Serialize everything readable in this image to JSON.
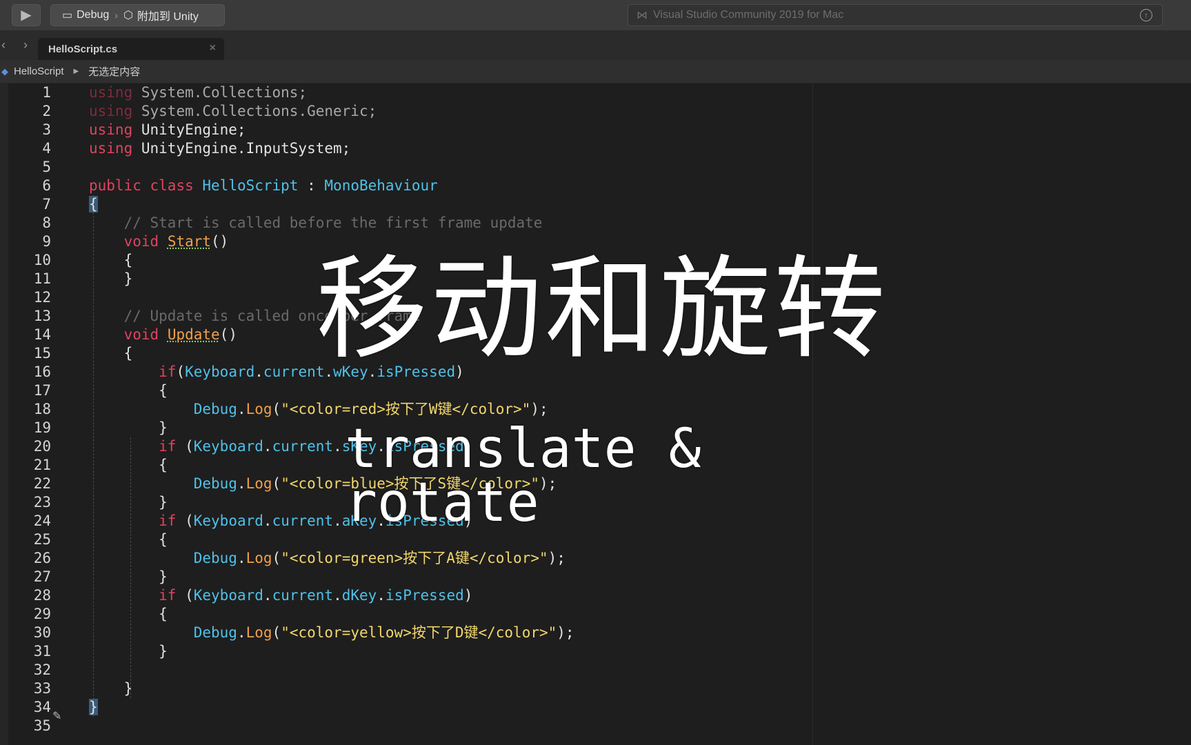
{
  "toolbar": {
    "run_icon": "play-icon",
    "config": "Debug",
    "separator": "›",
    "target": "附加到 Unity",
    "status_text": "Visual Studio Community 2019 for Mac"
  },
  "tabs": [
    {
      "label": "HelloScript.cs",
      "close": "×"
    }
  ],
  "breadcrumb": {
    "class_name": "HelloScript",
    "selection": "无选定内容"
  },
  "editor": {
    "line_numbers": [
      "1",
      "2",
      "3",
      "4",
      "5",
      "6",
      "7",
      "8",
      "9",
      "10",
      "11",
      "12",
      "13",
      "14",
      "15",
      "16",
      "17",
      "18",
      "19",
      "20",
      "21",
      "22",
      "23",
      "24",
      "25",
      "26",
      "27",
      "28",
      "29",
      "30",
      "31",
      "32",
      "33",
      "34",
      "35"
    ],
    "lines": [
      [
        [
          "kw-dim",
          "using"
        ],
        [
          "plain",
          " "
        ],
        [
          "ns-dim",
          "System.Collections;"
        ]
      ],
      [
        [
          "kw-dim",
          "using"
        ],
        [
          "plain",
          " "
        ],
        [
          "ns-dim",
          "System.Collections.Generic;"
        ]
      ],
      [
        [
          "kw",
          "using"
        ],
        [
          "plain",
          " UnityEngine;"
        ]
      ],
      [
        [
          "kw",
          "using"
        ],
        [
          "plain",
          " UnityEngine.InputSystem;"
        ]
      ],
      [],
      [
        [
          "kw",
          "public"
        ],
        [
          "plain",
          " "
        ],
        [
          "kw",
          "class"
        ],
        [
          "plain",
          " "
        ],
        [
          "type",
          "HelloScript"
        ],
        [
          "plain",
          " : "
        ],
        [
          "type",
          "MonoBehaviour"
        ]
      ],
      [
        [
          "brace-hi",
          "{"
        ]
      ],
      [
        [
          "cmt",
          "    // Start is called before the first frame update"
        ]
      ],
      [
        [
          "plain",
          "    "
        ],
        [
          "kw",
          "void"
        ],
        [
          "plain",
          " "
        ],
        [
          "method-u",
          "Start"
        ],
        [
          "plain",
          "()"
        ]
      ],
      [
        [
          "plain",
          "    {"
        ]
      ],
      [
        [
          "plain",
          "    }"
        ]
      ],
      [],
      [
        [
          "cmt",
          "    // Update is called once per frame"
        ]
      ],
      [
        [
          "plain",
          "    "
        ],
        [
          "kw",
          "void"
        ],
        [
          "plain",
          " "
        ],
        [
          "method-u",
          "Update"
        ],
        [
          "plain",
          "()"
        ]
      ],
      [
        [
          "plain",
          "    {"
        ]
      ],
      [
        [
          "plain",
          "        "
        ],
        [
          "kw",
          "if"
        ],
        [
          "plain",
          "("
        ],
        [
          "type",
          "Keyboard"
        ],
        [
          "plain",
          "."
        ],
        [
          "member",
          "current"
        ],
        [
          "plain",
          "."
        ],
        [
          "member",
          "wKey"
        ],
        [
          "plain",
          "."
        ],
        [
          "member",
          "isPressed"
        ],
        [
          "plain",
          ")"
        ]
      ],
      [
        [
          "plain",
          "        {"
        ]
      ],
      [
        [
          "plain",
          "            "
        ],
        [
          "type",
          "Debug"
        ],
        [
          "plain",
          "."
        ],
        [
          "method",
          "Log"
        ],
        [
          "plain",
          "("
        ],
        [
          "str",
          "\"<color=red>按下了W键</color>\""
        ],
        [
          "plain",
          ");"
        ]
      ],
      [
        [
          "plain",
          "        }"
        ]
      ],
      [
        [
          "plain",
          "        "
        ],
        [
          "kw",
          "if"
        ],
        [
          "plain",
          " ("
        ],
        [
          "type",
          "Keyboard"
        ],
        [
          "plain",
          "."
        ],
        [
          "member",
          "current"
        ],
        [
          "plain",
          "."
        ],
        [
          "member",
          "sKey"
        ],
        [
          "plain",
          "."
        ],
        [
          "member",
          "isPressed"
        ],
        [
          "plain",
          ")"
        ]
      ],
      [
        [
          "plain",
          "        {"
        ]
      ],
      [
        [
          "plain",
          "            "
        ],
        [
          "type",
          "Debug"
        ],
        [
          "plain",
          "."
        ],
        [
          "method",
          "Log"
        ],
        [
          "plain",
          "("
        ],
        [
          "str",
          "\"<color=blue>按下了S键</color>\""
        ],
        [
          "plain",
          ");"
        ]
      ],
      [
        [
          "plain",
          "        }"
        ]
      ],
      [
        [
          "plain",
          "        "
        ],
        [
          "kw",
          "if"
        ],
        [
          "plain",
          " ("
        ],
        [
          "type",
          "Keyboard"
        ],
        [
          "plain",
          "."
        ],
        [
          "member",
          "current"
        ],
        [
          "plain",
          "."
        ],
        [
          "member",
          "aKey"
        ],
        [
          "plain",
          "."
        ],
        [
          "member",
          "isPressed"
        ],
        [
          "plain",
          ")"
        ]
      ],
      [
        [
          "plain",
          "        {"
        ]
      ],
      [
        [
          "plain",
          "            "
        ],
        [
          "type",
          "Debug"
        ],
        [
          "plain",
          "."
        ],
        [
          "method",
          "Log"
        ],
        [
          "plain",
          "("
        ],
        [
          "str",
          "\"<color=green>按下了A键</color>\""
        ],
        [
          "plain",
          ");"
        ]
      ],
      [
        [
          "plain",
          "        }"
        ]
      ],
      [
        [
          "plain",
          "        "
        ],
        [
          "kw",
          "if"
        ],
        [
          "plain",
          " ("
        ],
        [
          "type",
          "Keyboard"
        ],
        [
          "plain",
          "."
        ],
        [
          "member",
          "current"
        ],
        [
          "plain",
          "."
        ],
        [
          "member",
          "dKey"
        ],
        [
          "plain",
          "."
        ],
        [
          "member",
          "isPressed"
        ],
        [
          "plain",
          ")"
        ]
      ],
      [
        [
          "plain",
          "        {"
        ]
      ],
      [
        [
          "plain",
          "            "
        ],
        [
          "type",
          "Debug"
        ],
        [
          "plain",
          "."
        ],
        [
          "method",
          "Log"
        ],
        [
          "plain",
          "("
        ],
        [
          "str",
          "\"<color=yellow>按下了D键</color>\""
        ],
        [
          "plain",
          ");"
        ]
      ],
      [
        [
          "plain",
          "        }"
        ]
      ],
      [],
      [
        [
          "plain",
          "    }"
        ]
      ],
      [
        [
          "brace-hi",
          "}"
        ]
      ],
      []
    ]
  },
  "overlay": {
    "title": "移动和旋转",
    "subtitle": "translate & rotate"
  }
}
